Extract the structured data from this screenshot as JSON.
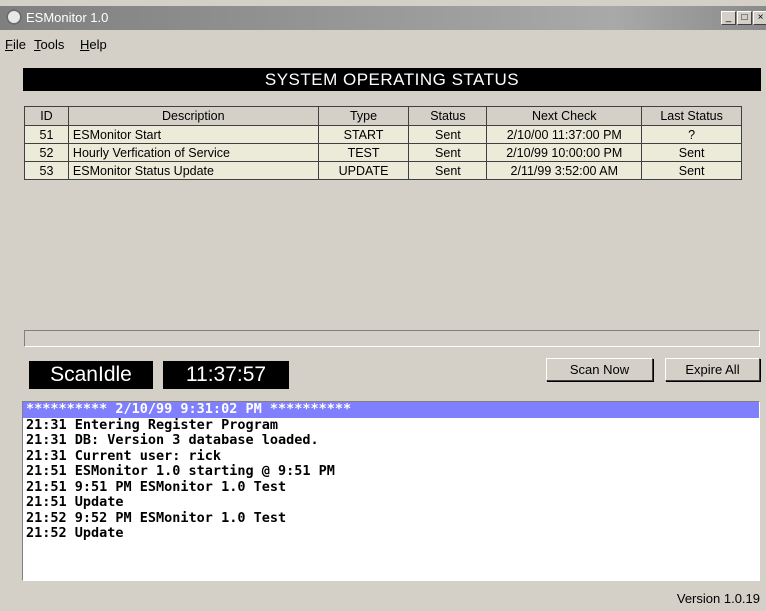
{
  "window": {
    "title": "ESMonitor 1.0"
  },
  "menu": [
    {
      "label": "File",
      "key": "F",
      "rest": "ile"
    },
    {
      "label": "Tools",
      "key": "T",
      "rest": "ools"
    },
    {
      "label": "Help",
      "key": "H",
      "rest": "elp"
    }
  ],
  "status_header": "SYSTEM OPERATING STATUS",
  "table": {
    "columns": [
      "ID",
      "Description",
      "Type",
      "Status",
      "Next Check",
      "Last Status"
    ],
    "rows": [
      [
        "51",
        "ESMonitor Start",
        "START",
        "Sent",
        "2/10/00 11:37:00 PM",
        "?"
      ],
      [
        "52",
        "Hourly Verfication of Service",
        "TEST",
        "Sent",
        "2/10/99 10:00:00 PM",
        "Sent"
      ],
      [
        "53",
        "ESMonitor Status Update",
        "UPDATE",
        "Sent",
        "2/11/99 3:52:00 AM",
        "Sent"
      ]
    ]
  },
  "scan_state": "ScanIdle",
  "clock": "11:37:57",
  "buttons": {
    "scan_now": "Scan Now",
    "expire_all": "Expire All"
  },
  "log": {
    "lines": [
      "********** 2/10/99 9:31:02 PM **********",
      "21:31 Entering Register Program",
      "21:31 DB: Version 3 database loaded.",
      "21:31 Current user: rick",
      "21:51 ESMonitor 1.0 starting @ 9:51 PM",
      "21:51 9:51 PM ESMonitor 1.0 Test",
      "21:51 Update",
      "21:52 9:52 PM ESMonitor 1.0 Test",
      "21:52 Update"
    ],
    "selected_index": 0
  },
  "version": "Version 1.0.19"
}
